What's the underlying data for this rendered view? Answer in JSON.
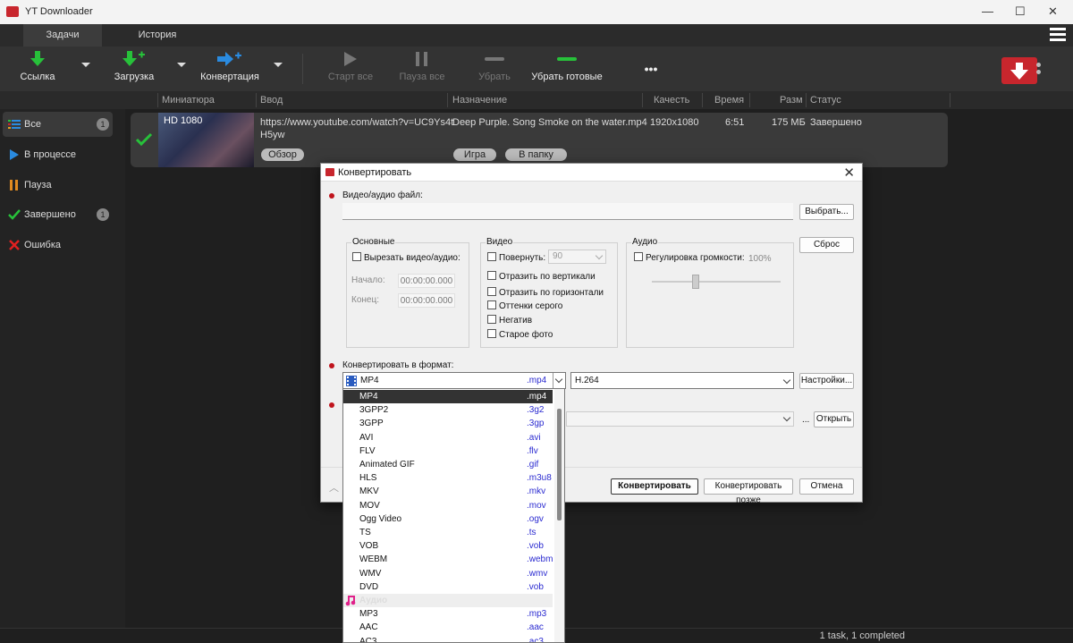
{
  "window": {
    "title": "YT Downloader"
  },
  "tabs": [
    {
      "label": "Задачи"
    },
    {
      "label": "История"
    }
  ],
  "toolbar": {
    "link": "Ссылка",
    "download": "Загрузка",
    "convert": "Конвертация",
    "start_all": "Старт все",
    "pause_all": "Пауза все",
    "remove": "Убрать",
    "remove_done": "Убрать готовые",
    "more": "•••"
  },
  "columns": {
    "thumb": "Миниатюра",
    "input": "Ввод",
    "dest": "Назначение",
    "quality": "Качесть",
    "time": "Время",
    "size": "Разм",
    "status": "Статус"
  },
  "sidebar": {
    "items": [
      {
        "label": "Все",
        "count": "1"
      },
      {
        "label": "В процессе"
      },
      {
        "label": "Пауза"
      },
      {
        "label": "Завершено",
        "count": "1"
      },
      {
        "label": "Ошибка"
      }
    ]
  },
  "task": {
    "badge": "HD 1080",
    "url_line1": "https://www.youtube.com/watch?v=UC9Ys4t",
    "url_line2": "H5yw",
    "file": "Deep Purple. Song Smoke on the water.mp4",
    "quality": "1920x1080",
    "time": "6:51",
    "size": "175 МБ",
    "status": "Завершено",
    "btn_browse": "Обзор",
    "btn_play": "Игра",
    "btn_folder": "В папку"
  },
  "status_bar": "1 task, 1 completed",
  "dialog": {
    "title": "Конвертировать",
    "file_label": "Видео/аудио файл:",
    "choose": "Выбрать...",
    "reset": "Сброс",
    "basic": {
      "title": "Основные",
      "cut": "Вырезать видео/аудио:",
      "start": "Начало:",
      "end": "Конец:",
      "start_val": "00:00:00.000",
      "end_val": "00:00:00.000"
    },
    "video": {
      "title": "Видео",
      "rotate": "Повернуть:",
      "rotate_val": "90",
      "flip_v": "Отразить по вертикали",
      "flip_h": "Отразить по горизонтали",
      "gray": "Оттенки серого",
      "negative": "Негатив",
      "old": "Старое фото"
    },
    "audio": {
      "title": "Аудио",
      "volume": "Регулировка громкости:",
      "volume_val": "100%"
    },
    "format_label": "Конвертировать в формат:",
    "format_selected": "MP4",
    "format_ext": ".mp4",
    "codec": "H.264",
    "settings": "Настройки...",
    "ellipsis": "...",
    "open": "Открыть",
    "convert": "Конвертировать",
    "later": "Конвертировать позже",
    "cancel": "Отмена"
  },
  "format_list": [
    {
      "name": "MP4",
      "ext": ".mp4"
    },
    {
      "name": "3GPP2",
      "ext": ".3g2"
    },
    {
      "name": "3GPP",
      "ext": ".3gp"
    },
    {
      "name": "AVI",
      "ext": ".avi"
    },
    {
      "name": "FLV",
      "ext": ".flv"
    },
    {
      "name": "Animated GIF",
      "ext": ".gif"
    },
    {
      "name": "HLS",
      "ext": ".m3u8"
    },
    {
      "name": "MKV",
      "ext": ".mkv"
    },
    {
      "name": "MOV",
      "ext": ".mov"
    },
    {
      "name": "Ogg Video",
      "ext": ".ogv"
    },
    {
      "name": "TS",
      "ext": ".ts"
    },
    {
      "name": "VOB",
      "ext": ".vob"
    },
    {
      "name": "WEBM",
      "ext": ".webm"
    },
    {
      "name": "WMV",
      "ext": ".wmv"
    },
    {
      "name": "DVD",
      "ext": ".vob"
    },
    {
      "category": "Аудио"
    },
    {
      "name": "MP3",
      "ext": ".mp3"
    },
    {
      "name": "AAC",
      "ext": ".aac"
    },
    {
      "name": "AC3",
      "ext": ".ac3"
    }
  ],
  "colors": {
    "accent_green": "#27c13a",
    "accent_blue": "#2a8be0",
    "brand_red": "#c8262d"
  }
}
